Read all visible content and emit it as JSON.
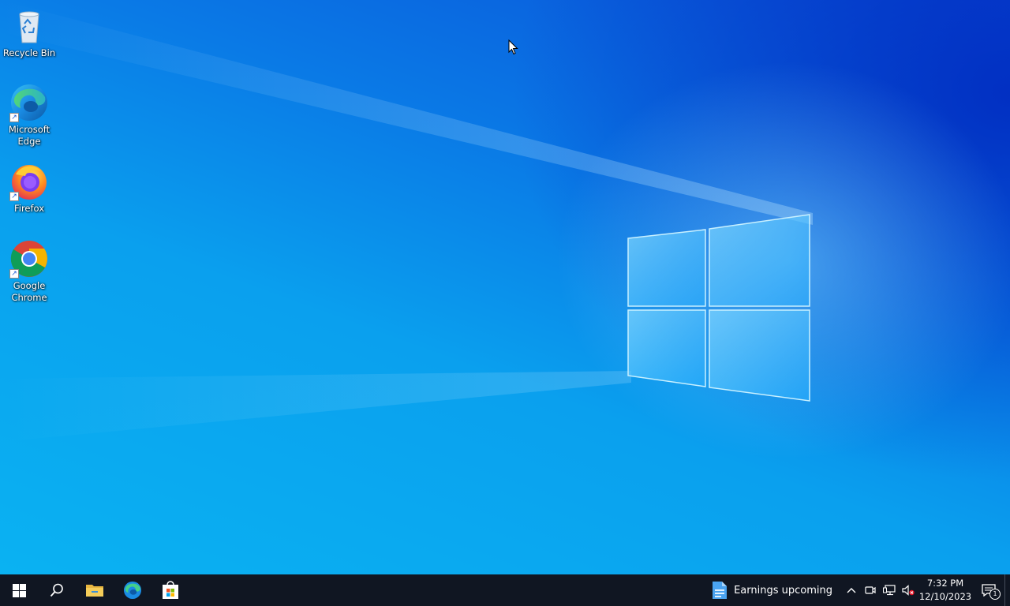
{
  "desktop": {
    "icons": [
      {
        "label": "Recycle Bin",
        "icon": "recycle-bin-icon",
        "shortcut": false
      },
      {
        "label": "Microsoft Edge",
        "icon": "edge-icon",
        "shortcut": true
      },
      {
        "label": "Firefox",
        "icon": "firefox-icon",
        "shortcut": true
      },
      {
        "label": "Google Chrome",
        "icon": "chrome-icon",
        "shortcut": true
      }
    ]
  },
  "taskbar": {
    "pinned": [
      "start-icon",
      "search-icon",
      "file-explorer-icon",
      "edge-icon",
      "microsoft-store-icon"
    ],
    "news": {
      "text": "Earnings upcoming",
      "icon": "news-stocks-icon"
    },
    "tray_icons": [
      "chevron-up-icon",
      "meet-now-icon",
      "network-icon",
      "volume-muted-icon"
    ],
    "clock": {
      "time": "7:32 PM",
      "date": "12/10/2023"
    },
    "notifications": {
      "count": "1"
    }
  },
  "colors": {
    "taskbar": "#101622",
    "desktop_accent": "#0a7ae6"
  }
}
